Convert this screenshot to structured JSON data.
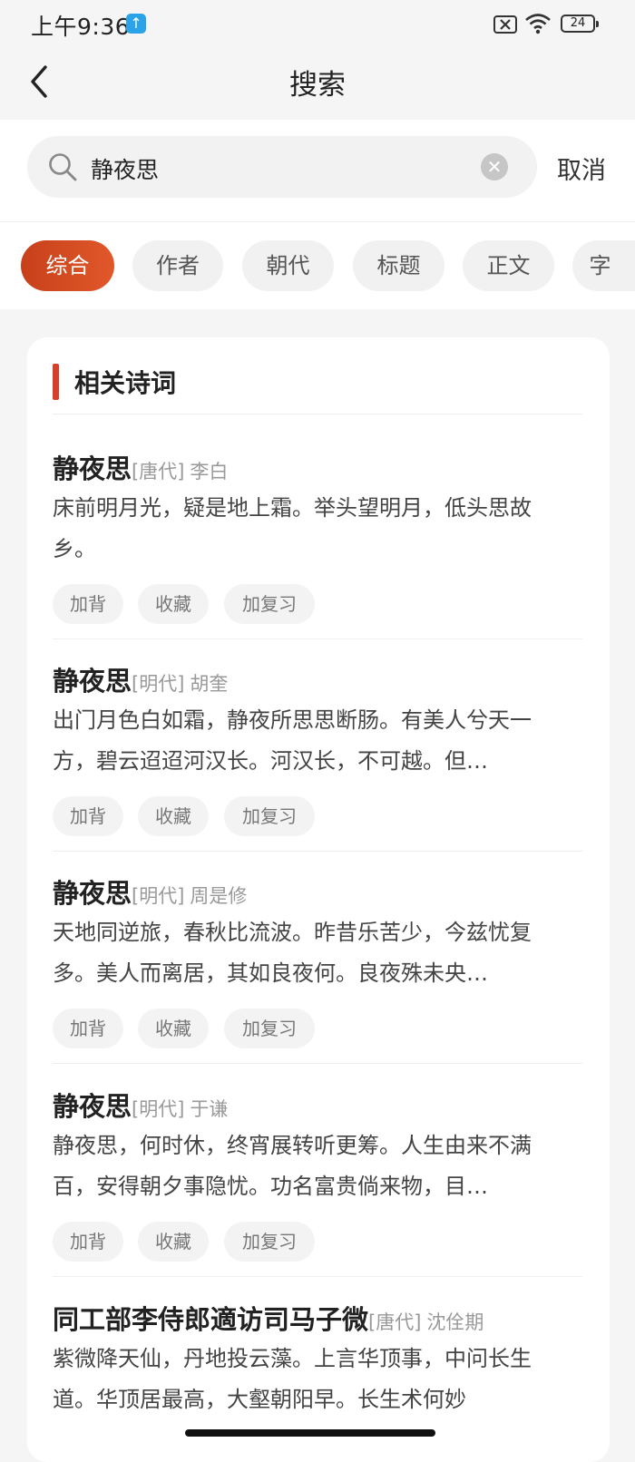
{
  "status_bar": {
    "time": "上午9:36",
    "upload_icon": "upload-icon",
    "battery": "24"
  },
  "nav": {
    "title": "搜索",
    "back_icon": "chevron-left-icon"
  },
  "search": {
    "query": "静夜思",
    "cancel": "取消",
    "clear_icon": "clear-icon",
    "search_icon": "search-icon"
  },
  "tabs": [
    "综合",
    "作者",
    "朝代",
    "标题",
    "正文",
    "字"
  ],
  "section_title": "相关诗词",
  "accent_color": "#d4402b",
  "poems": [
    {
      "title": "静夜思",
      "dynasty": "[唐代]",
      "author": "李白",
      "content": "床前明月光，疑是地上霜。举头望明月，低头思故乡。"
    },
    {
      "title": "静夜思",
      "dynasty": "[明代]",
      "author": "胡奎",
      "content": "出门月色白如霜，静夜所思思断肠。有美人兮天一方，碧云迢迢河汉长。河汉长，不可越。但…"
    },
    {
      "title": "静夜思",
      "dynasty": "[明代]",
      "author": "周是修",
      "content": "天地同逆旅，春秋比流波。昨昔乐苦少，今兹忧复多。美人而离居，其如良夜何。良夜殊未央…"
    },
    {
      "title": "静夜思",
      "dynasty": "[明代]",
      "author": "于谦",
      "content": "静夜思，何时休，终宵展转听更筹。人生由来不满百，安得朝夕事隐忧。功名富贵倘来物，目…"
    },
    {
      "title": "同工部李侍郎適访司马子微",
      "dynasty": "[唐代]",
      "author": "沈佺期",
      "content": "紫微降天仙，丹地投云藻。上言华顶事，中问长生道。华顶居最高，大壑朝阳早。长生术何妙"
    }
  ],
  "actions": {
    "recite": "加背",
    "favorite": "收藏",
    "review": "加复习"
  }
}
